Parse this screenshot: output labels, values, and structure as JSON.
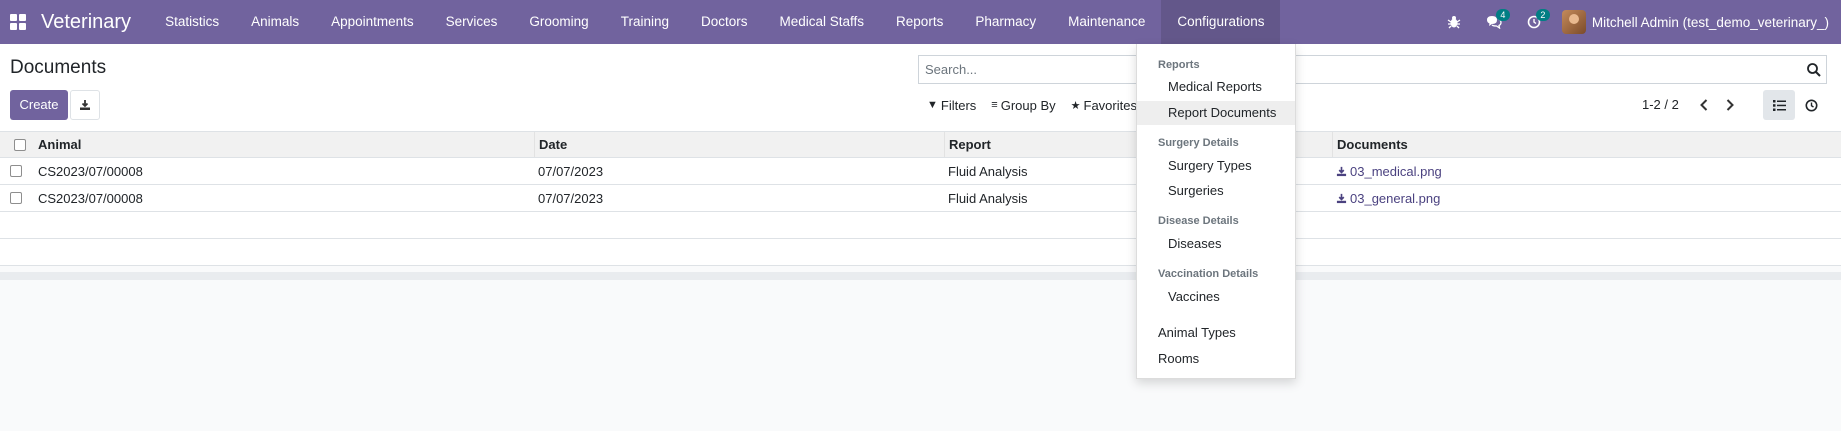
{
  "navbar": {
    "brand": "Veterinary",
    "menu": [
      "Statistics",
      "Animals",
      "Appointments",
      "Services",
      "Grooming",
      "Training",
      "Doctors",
      "Medical Staffs",
      "Reports",
      "Pharmacy",
      "Maintenance",
      "Configurations"
    ],
    "open_menu": "Configurations",
    "messages_count": "4",
    "activities_count": "2",
    "user_name": "Mitchell Admin (test_demo_veterinary_)"
  },
  "control_panel": {
    "title": "Documents",
    "create_label": "Create",
    "search_placeholder": "Search...",
    "filters_label": "Filters",
    "group_by_label": "Group By",
    "favorites_label": "Favorites",
    "pager": "1-2 / 2"
  },
  "table": {
    "columns": [
      "Animal",
      "Date",
      "Report",
      "Documents"
    ],
    "rows": [
      {
        "animal": "CS2023/07/00008",
        "date": "07/07/2023",
        "report": "Fluid Analysis",
        "document": "03_medical.png"
      },
      {
        "animal": "CS2023/07/00008",
        "date": "07/07/2023",
        "report": "Fluid Analysis",
        "document": "03_general.png"
      }
    ]
  },
  "dropdown": {
    "sections": [
      {
        "header": "Reports",
        "items": [
          "Medical Reports",
          "Report Documents"
        ]
      },
      {
        "header": "Surgery Details",
        "items": [
          "Surgery Types",
          "Surgeries"
        ]
      },
      {
        "header": "Disease Details",
        "items": [
          "Diseases"
        ]
      },
      {
        "header": "Vaccination Details",
        "items": [
          "Vaccines"
        ]
      }
    ],
    "top_items": [
      "Animal Types",
      "Rooms"
    ],
    "highlighted_item": "Report Documents"
  },
  "colors": {
    "brand": "#71639e",
    "badge": "#017e84",
    "link": "#4b4280"
  }
}
